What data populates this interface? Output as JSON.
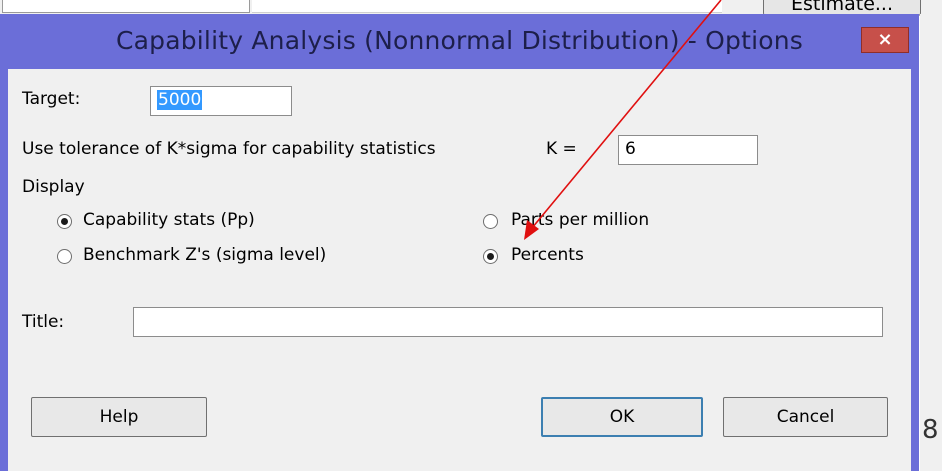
{
  "background": {
    "button_label": "Estimate..."
  },
  "dialog": {
    "title": "Capability Analysis (Nonnormal Distribution) - Options",
    "close_glyph": "×",
    "target": {
      "label": "Target:",
      "value": "5000"
    },
    "tolerance": {
      "label": "Use tolerance of K*sigma for capability statistics",
      "k_label": "K =",
      "k_value": "6"
    },
    "display": {
      "label": "Display",
      "options": [
        {
          "label": "Capability stats (Pp)",
          "selected": true
        },
        {
          "label": "Parts per million",
          "selected": false
        },
        {
          "label": "Benchmark Z's (sigma level)",
          "selected": false
        },
        {
          "label": "Percents",
          "selected": true
        }
      ]
    },
    "title_field": {
      "label": "Title:",
      "value": ""
    },
    "buttons": {
      "help": "Help",
      "ok": "OK",
      "cancel": "Cancel"
    }
  },
  "colors": {
    "frame": "#6b6ed8",
    "close": "#c7504a",
    "selection": "#3399ff",
    "arrow": "#e01010"
  }
}
